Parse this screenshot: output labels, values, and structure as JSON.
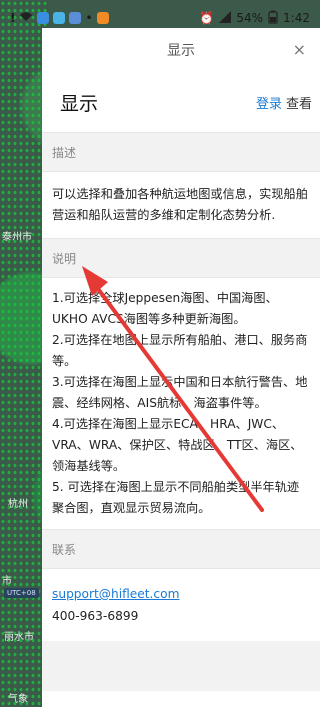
{
  "status_bar": {
    "battery": "54%",
    "time": "1:42"
  },
  "map": {
    "labels": [
      "泰州市",
      "杭州",
      "市",
      "丽水市",
      "气象"
    ]
  },
  "panel": {
    "header_title": "显示",
    "close_icon": "×",
    "page_title": "显示",
    "login_label": "登录",
    "view_label": "查看",
    "sections": {
      "description": {
        "title": "描述",
        "text": "可以选择和叠加各种航运地图或信息，实现船舶营运和船队运营的多维和定制化态势分析."
      },
      "notes": {
        "title": "说明",
        "items": [
          "1.可选择全球Jeppesen海图、中国海图、UKHO AVCS海图等多种更新海图。",
          "2.可选择在地图上显示所有船舶、港口、服务商等。",
          "3.可选择在海图上显示中国和日本航行警告、地震、经纬网格、AIS航标、海盗事件等。",
          "4.可选择在海图上显示ECA、HRA、JWC、VRA、WRA、保护区、特战区、TT区、海区、领海基线等。",
          "5. 可选择在海图上显示不同船舶类型半年轨迹聚合图，直观显示贸易流向。"
        ]
      },
      "contact": {
        "title": "联系",
        "email": "support@hifleet.com",
        "phone": "400-963-6899"
      }
    }
  },
  "colors": {
    "accent": "#1a7ad6",
    "arrow": "#e53935",
    "map_dots": "#19c23e"
  }
}
